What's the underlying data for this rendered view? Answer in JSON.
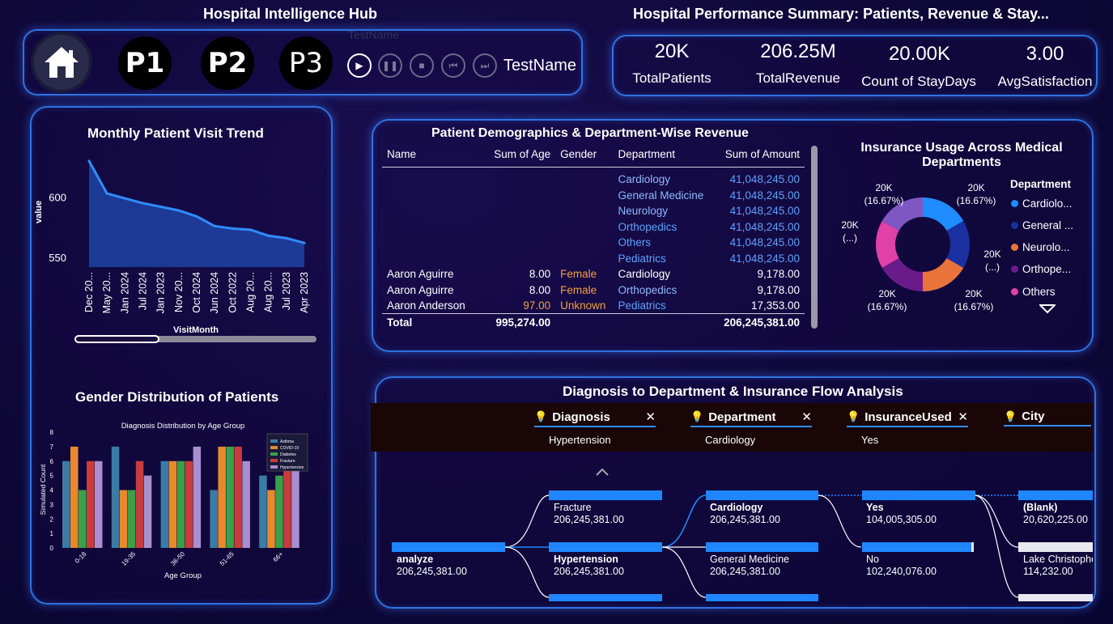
{
  "header": {
    "hub_title": "Hospital Intelligence Hub",
    "summary_title": "Hospital Performance Summary: Patients, Revenue & Stay...",
    "ghost_label": "TestName",
    "nav": [
      "P1",
      "P2",
      "P3"
    ],
    "player_label": "TestName"
  },
  "kpis": [
    {
      "value": "20K",
      "label": "TotalPatients"
    },
    {
      "value": "206.25M",
      "label": "TotalRevenue"
    },
    {
      "value": "20.00K",
      "label": "Count of StayDays"
    },
    {
      "value": "3.00",
      "label": "AvgSatisfaction"
    }
  ],
  "visit_trend": {
    "title": "Monthly Patient Visit Trend",
    "ylabel": "value",
    "xlabel": "VisitMonth",
    "y_ticks": [
      "600",
      "550"
    ],
    "x_ticks": [
      "Dec 20...",
      "May 20...",
      "Jan 2024",
      "Jul 2024",
      "Jan 2023",
      "Nov 20...",
      "Oct 2024",
      "Jun 2024",
      "Oct 2022",
      "Aug 20...",
      "Aug 20...",
      "Jul 2023",
      "Apr 2023"
    ]
  },
  "gender": {
    "title": "Gender Distribution of Patients",
    "inner_title": "Diagnosis Distribution by Age Group",
    "xlabel": "Age Group",
    "ylabel": "Simulated Count",
    "y_ticks": [
      "8",
      "7",
      "6",
      "5",
      "4",
      "3",
      "2",
      "1",
      "0"
    ],
    "legend": [
      "Asthma",
      "COVID-19",
      "Diabetes",
      "Fracture",
      "Hypertension"
    ]
  },
  "demographics": {
    "title": "Patient Demographics & Department-Wise Revenue",
    "columns": [
      "Name",
      "Sum of Age",
      "Gender",
      "Department",
      "Sum of Amount"
    ],
    "rows": [
      {
        "name": "",
        "age": "",
        "gender": "",
        "dept": "Cardiology",
        "amount": "41,048,245.00"
      },
      {
        "name": "",
        "age": "",
        "gender": "",
        "dept": "General Medicine",
        "amount": "41,048,245.00"
      },
      {
        "name": "",
        "age": "",
        "gender": "",
        "dept": "Neurology",
        "amount": "41,048,245.00"
      },
      {
        "name": "",
        "age": "",
        "gender": "",
        "dept": "Orthopedics",
        "amount": "41,048,245.00"
      },
      {
        "name": "",
        "age": "",
        "gender": "",
        "dept": "Others",
        "amount": "41,048,245.00"
      },
      {
        "name": "",
        "age": "",
        "gender": "",
        "dept": "Pediatrics",
        "amount": "41,048,245.00"
      },
      {
        "name": "Aaron Aguirre",
        "age": "8.00",
        "gender": "Female",
        "dept": "Cardiology",
        "amount": "9,178.00"
      },
      {
        "name": "Aaron Aguirre",
        "age": "8.00",
        "gender": "Female",
        "dept": "Orthopedics",
        "amount": "9,178.00"
      },
      {
        "name": "Aaron Anderson",
        "age": "97.00",
        "gender": "Unknown",
        "dept": "Pediatrics",
        "amount": "17,353.00"
      }
    ],
    "total": {
      "label": "Total",
      "age": "995,274.00",
      "amount": "206,245,381.00"
    }
  },
  "insurance": {
    "title": "Insurance Usage Across Medical Departments",
    "legend_title": "Department",
    "legend": [
      {
        "label": "Cardiolo...",
        "color": "#1f8cff"
      },
      {
        "label": "General ...",
        "color": "#1a2fa0"
      },
      {
        "label": "Neurolo...",
        "color": "#e8743b"
      },
      {
        "label": "Orthope...",
        "color": "#6a1b8a"
      },
      {
        "label": "Others",
        "color": "#e040a8"
      }
    ],
    "labels": [
      {
        "v": "20K",
        "p": "(16.67%)"
      },
      {
        "v": "20K",
        "p": "(...)"
      },
      {
        "v": "20K",
        "p": "(16.67%)"
      },
      {
        "v": "20K",
        "p": "(16.67%)"
      },
      {
        "v": "20K",
        "p": "(...)"
      },
      {
        "v": "20K",
        "p": "(16.67%)"
      }
    ]
  },
  "flow": {
    "title": "Diagnosis to Department & Insurance Flow Analysis",
    "filters": [
      {
        "head": "Diagnosis",
        "value": "Hypertension"
      },
      {
        "head": "Department",
        "value": "Cardiology"
      },
      {
        "head": "InsuranceUsed",
        "value": "Yes"
      },
      {
        "head": "City",
        "value": ""
      }
    ],
    "root": {
      "name": "analyze",
      "value": "206,245,381.00"
    },
    "diag": [
      {
        "name": "Fracture",
        "value": "206,245,381.00"
      },
      {
        "name": "Hypertension",
        "value": "206,245,381.00"
      }
    ],
    "dept": [
      {
        "name": "Cardiology",
        "value": "206,245,381.00"
      },
      {
        "name": "General Medicine",
        "value": "206,245,381.00"
      }
    ],
    "ins": [
      {
        "name": "Yes",
        "value": "104,005,305.00"
      },
      {
        "name": "No",
        "value": "102,240,076.00"
      }
    ],
    "city": [
      {
        "name": "(Blank)",
        "value": "20,620,225.00"
      },
      {
        "name": "Lake Christophe",
        "value": "114,232.00"
      }
    ]
  },
  "chart_data": [
    {
      "type": "area",
      "title": "Monthly Patient Visit Trend",
      "xlabel": "VisitMonth",
      "ylabel": "value",
      "categories": [
        "Dec 20...",
        "May 20...",
        "Jan 2024",
        "Jul 2024",
        "Jan 2023",
        "Nov 20...",
        "Oct 2024",
        "Jun 2024",
        "Oct 2022",
        "Aug 20...",
        "Aug 20...",
        "Jul 2023",
        "Apr 2023"
      ],
      "values": [
        630,
        603,
        599,
        595,
        592,
        589,
        584,
        576,
        574,
        573,
        568,
        566,
        562
      ],
      "ylim": [
        542,
        640
      ]
    },
    {
      "type": "bar",
      "title": "Diagnosis Distribution by Age Group",
      "xlabel": "Age Group",
      "ylabel": "Simulated Count",
      "categories": [
        "0-18",
        "19-35",
        "36-50",
        "51-65",
        "66+"
      ],
      "series": [
        {
          "name": "Asthma",
          "color": "#3a7ca5",
          "values": [
            6,
            7,
            6,
            4,
            5
          ]
        },
        {
          "name": "COVID-19",
          "color": "#e8892b",
          "values": [
            7,
            4,
            6,
            7,
            4
          ]
        },
        {
          "name": "Diabetes",
          "color": "#3aa04a",
          "values": [
            4,
            4,
            6,
            7,
            5
          ]
        },
        {
          "name": "Fracture",
          "color": "#c83c3c",
          "values": [
            6,
            6,
            6,
            7,
            7
          ]
        },
        {
          "name": "Hypertension",
          "color": "#a98fd0",
          "values": [
            6,
            5,
            7,
            6,
            6
          ]
        }
      ],
      "ylim": [
        0,
        8
      ]
    },
    {
      "type": "pie",
      "title": "Insurance Usage Across Medical Departments",
      "categories": [
        "Cardiology",
        "General Medicine",
        "Neurology",
        "Orthopedics",
        "Others",
        "Pediatrics"
      ],
      "values": [
        20000,
        20000,
        20000,
        20000,
        20000,
        20000
      ],
      "colors": [
        "#1f8cff",
        "#1a2fa0",
        "#e8743b",
        "#6a1b8a",
        "#e040a8",
        "#7e57c2"
      ]
    }
  ]
}
